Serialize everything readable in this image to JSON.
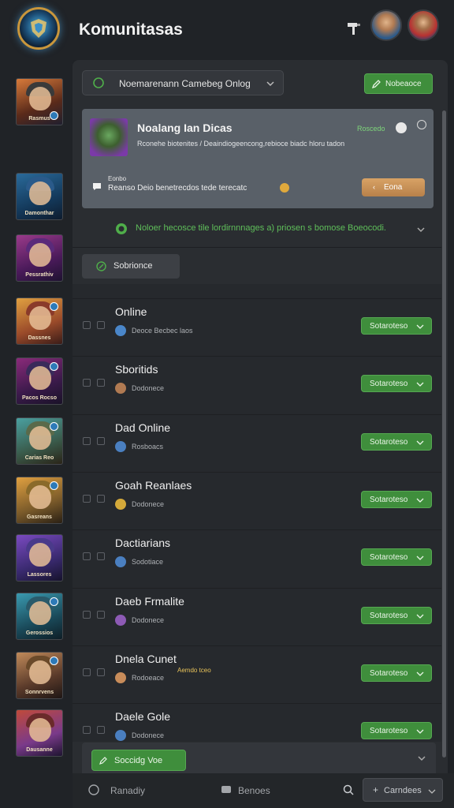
{
  "header": {
    "title": "Komunitasas",
    "logo_icon": "shield-emblem-icon",
    "tool_icon": "hammer-icon",
    "avatars": [
      "player-avatar-1",
      "player-avatar-2"
    ]
  },
  "rail": {
    "items": [
      {
        "caption": "Rasmus",
        "badge": true
      },
      {
        "caption": "Damonthar",
        "badge": false
      },
      {
        "caption": "Pessrathiv",
        "badge": false
      },
      {
        "caption": "Dassnes",
        "badge": true
      },
      {
        "caption": "Pacos Rocso",
        "badge": true
      },
      {
        "caption": "Carias Reo",
        "badge": true
      },
      {
        "caption": "Gasreans",
        "badge": true
      },
      {
        "caption": "Lassores",
        "badge": false
      },
      {
        "caption": "Gerossios",
        "badge": true
      },
      {
        "caption": "Sonnrvens",
        "badge": true
      },
      {
        "caption": "Dausanne",
        "badge": false
      }
    ]
  },
  "filter": {
    "label": "Noemarenann Camebeg Onlog",
    "top_button": "Nobeaoce"
  },
  "featured": {
    "title": "Noalang Ian Dicas",
    "description": "Rconehe biotenites / Deaindiogeencong,rebioce biadc hloru tadon",
    "status": "Roscedo",
    "sub_label": "Eonbo",
    "sub_text": "Reanso Deio benetrecdos tede terecatc",
    "button": "Eona"
  },
  "notice": "Noloer hecosce tile lordirnnnages a) priosen s bomose Boeocodi.",
  "section_button": "Sobrionce",
  "rows": [
    {
      "name": "Online",
      "sub": "Deoce Becbec laos",
      "icon_color": "#4a86c9",
      "tag": "",
      "button": "Sotaroteso"
    },
    {
      "name": "Sboritids",
      "sub": "Dodonece",
      "icon_color": "#b07a52",
      "tag": "",
      "button": "Sotaroteso"
    },
    {
      "name": "Dad Online",
      "sub": "Rosboacs",
      "icon_color": "#4a7fc0",
      "tag": "",
      "button": "Sotaroteso"
    },
    {
      "name": "Goah Reanlaes",
      "sub": "Dodonece",
      "icon_color": "#d4a93a",
      "tag": "",
      "button": "Sotaroteso"
    },
    {
      "name": "Dactiarians",
      "sub": "Sodotiace",
      "icon_color": "#4a7fc0",
      "tag": "",
      "button": "Sotaroteso"
    },
    {
      "name": "Daeb Frmalite",
      "sub": "Dodonece",
      "icon_color": "#8d5ab5",
      "tag": "",
      "button": "Sotaroteso"
    },
    {
      "name": "Dnela Cunet",
      "sub": "Rodoeace",
      "icon_color": "#c88c5a",
      "tag": "Aemdo tceo",
      "button": "Sotaroteso"
    },
    {
      "name": "Daele Gole",
      "sub": "Dodonece",
      "icon_color": "#4a7fc0",
      "tag": "",
      "button": "Sotaroteso"
    }
  ],
  "bottom_panel": {
    "button": "Soccidg Voe"
  },
  "footer": {
    "left_label": "Ranadiy",
    "mid_label": "Benoes",
    "right_button": "Carndees"
  },
  "colors": {
    "accent_green": "#3f8e3c",
    "accent_orange": "#c8904f",
    "panel": "#2a2d31",
    "background": "#1f2226"
  }
}
